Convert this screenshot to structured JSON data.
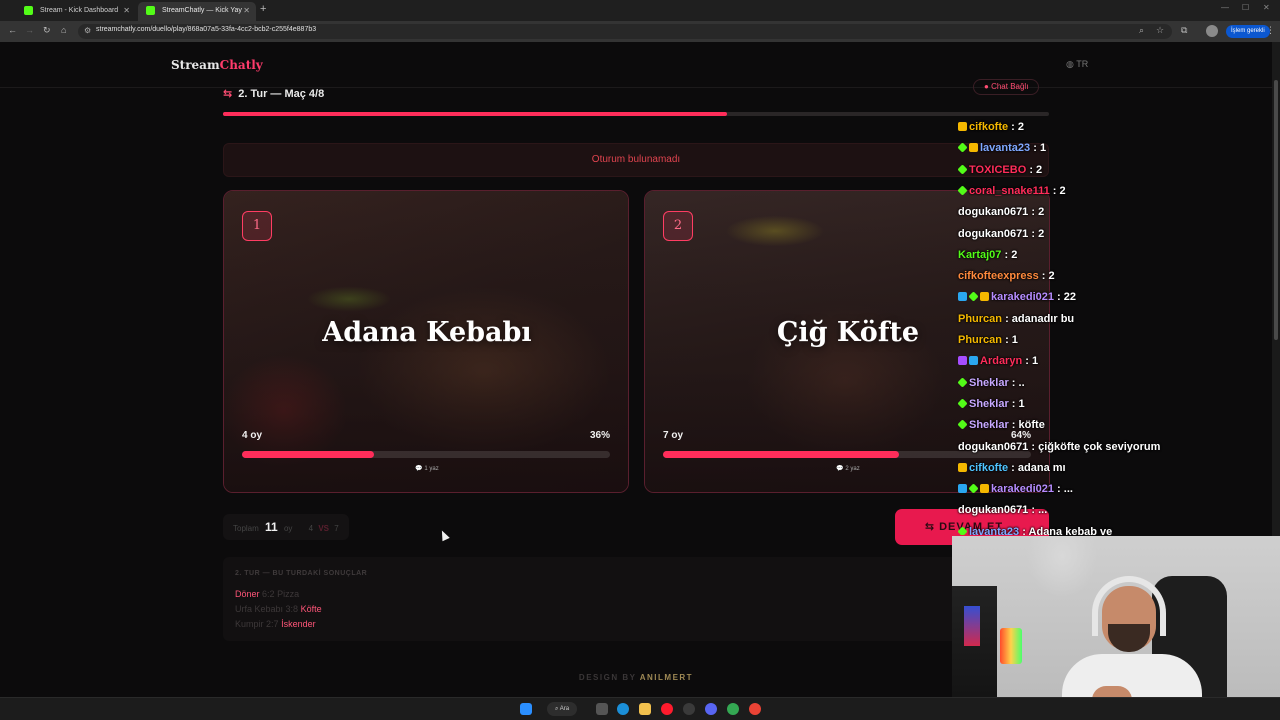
{
  "browser": {
    "tabs": [
      {
        "title": "Stream - Kick Dashboard",
        "favicon_color": "#53fc18"
      },
      {
        "title": "StreamChatly — Kick Yayıncılar",
        "favicon_color": "#53fc18"
      }
    ],
    "url": "streamchatly.com/duello/play/868a07a5-33fa-4cc2-bcb2-c255f4e887b3",
    "action_pill": "İşlem gerekli"
  },
  "site": {
    "logo_part1": "Stream",
    "logo_part2": "Chatly",
    "accent_color": "#ff2d5a",
    "language": "TR"
  },
  "round": {
    "title": "2. Tur — Maç 4/8",
    "chat_link": "Chat Bağlı",
    "progress": 0.61
  },
  "alert": "Oturum bulunamadı",
  "options": [
    {
      "number": "1",
      "name": "Adana Kebabı",
      "votes": "4 oy",
      "percent_label": "36%",
      "percent": 36,
      "writes": "1 yaz"
    },
    {
      "number": "2",
      "name": "Çiğ Köfte",
      "votes": "7 oy",
      "percent_label": "64%",
      "percent": 64,
      "writes": "2 yaz"
    }
  ],
  "total": {
    "label": "Toplam",
    "count": "11",
    "unit": "oy",
    "left": "4",
    "vs": "VS",
    "right": "7"
  },
  "continue_button": "DEVAM ET",
  "results": {
    "header": "2. TUR — BU TURDAKİ SONUÇLAR",
    "rows": [
      {
        "winner": "Döner",
        "score": "6:2",
        "loser": "Pizza",
        "winner_first": true
      },
      {
        "winner": "Köfte",
        "score": "3:8",
        "loser": "Urfa Kebabı",
        "winner_first": false
      },
      {
        "winner": "İskender",
        "score": "2:7",
        "loser": "Kumpir",
        "winner_first": false
      }
    ]
  },
  "footer": {
    "prefix": "DESIGN BY",
    "author": "ANILMERT"
  },
  "taskbar": {
    "search_label": "Ara"
  },
  "chat": [
    {
      "user": "cifkofte",
      "text": "2",
      "color": "#f5b800",
      "badges": [
        "gold"
      ]
    },
    {
      "user": "lavanta23",
      "text": "1",
      "color": "#7fa8ff",
      "badges": [
        "green",
        "gold"
      ]
    },
    {
      "user": "TOXICEBO",
      "text": "2",
      "color": "#ff2d5a",
      "badges": [
        "green"
      ]
    },
    {
      "user": "coral_snake111",
      "text": "2",
      "color": "#ff2d5a",
      "badges": [
        "green"
      ]
    },
    {
      "user": "dogukan0671",
      "text": "2",
      "color": "#ffffff",
      "badges": []
    },
    {
      "user": "dogukan0671",
      "text": "2",
      "color": "#ffffff",
      "badges": []
    },
    {
      "user": "Kartaj07",
      "text": "2",
      "color": "#53fc18",
      "badges": []
    },
    {
      "user": "cifkofteexpress",
      "text": "2",
      "color": "#ff8a3d",
      "badges": []
    },
    {
      "user": "karakedi021",
      "text": "22",
      "color": "#b78cff",
      "badges": [
        "blue",
        "green",
        "gold"
      ]
    },
    {
      "user": "Phurcan",
      "text": "adanadır bu",
      "color": "#f5b800",
      "badges": []
    },
    {
      "user": "Phurcan",
      "text": "1",
      "color": "#f5b800",
      "badges": []
    },
    {
      "user": "Ardaryn",
      "text": "1",
      "color": "#ff2d5a",
      "badges": [
        "purple",
        "blue"
      ]
    },
    {
      "user": "Sheklar",
      "text": "..",
      "color": "#c7a8ff",
      "badges": [
        "green"
      ]
    },
    {
      "user": "Sheklar",
      "text": "1",
      "color": "#c7a8ff",
      "badges": [
        "green"
      ]
    },
    {
      "user": "Sheklar",
      "text": "köfte",
      "color": "#c7a8ff",
      "badges": [
        "green"
      ]
    },
    {
      "user": "dogukan0671",
      "text": "çiğköfte çok seviyorum",
      "color": "#ffffff",
      "badges": []
    },
    {
      "user": "cifkofte",
      "text": "adana mı",
      "color": "#4fc3ff",
      "badges": [
        "gold"
      ]
    },
    {
      "user": "karakedi021",
      "text": "...",
      "color": "#b78cff",
      "badges": [
        "blue",
        "green",
        "gold"
      ]
    },
    {
      "user": "dogukan0671",
      "text": "...",
      "color": "#ffffff",
      "badges": []
    },
    {
      "user": "lavanta23",
      "text": "Adana kebab ve",
      "color": "#7fa8ff",
      "badges": [
        "green"
      ]
    }
  ]
}
